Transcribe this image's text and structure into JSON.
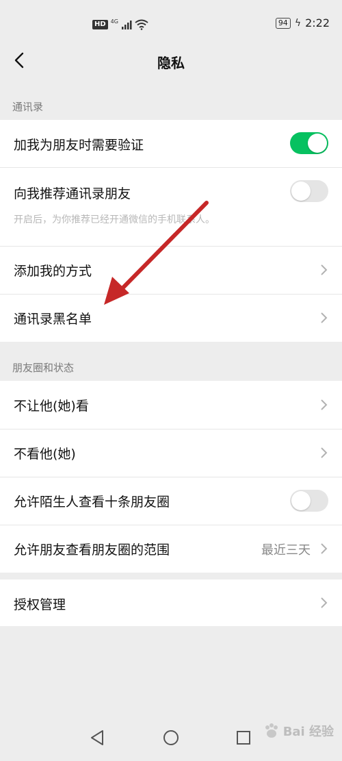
{
  "status_bar": {
    "hd_label": "HD",
    "network_label": "4G",
    "battery_level": "94",
    "time": "2:22"
  },
  "header": {
    "title": "隐私",
    "back_icon": "chevron-left-icon"
  },
  "sections": {
    "contacts": {
      "title": "通讯录",
      "items": [
        {
          "label": "加我为朋友时需要验证",
          "control": "toggle",
          "on": true
        },
        {
          "label": "向我推荐通讯录朋友",
          "sublabel": "开启后，为你推荐已经开通微信的手机联系人。",
          "control": "toggle",
          "on": false
        },
        {
          "label": "添加我的方式",
          "control": "chevron"
        },
        {
          "label": "通讯录黑名单",
          "control": "chevron"
        }
      ]
    },
    "moments": {
      "title": "朋友圈和状态",
      "items": [
        {
          "label": "不让他(她)看",
          "control": "chevron"
        },
        {
          "label": "不看他(她)",
          "control": "chevron"
        },
        {
          "label": "允许陌生人查看十条朋友圈",
          "control": "toggle",
          "on": false
        },
        {
          "label": "允许朋友查看朋友圈的范围",
          "value": "最近三天",
          "control": "chevron"
        }
      ]
    },
    "auth": {
      "items": [
        {
          "label": "授权管理",
          "control": "chevron"
        }
      ]
    }
  },
  "colors": {
    "accent": "#07c160",
    "annotation_arrow": "#c62828",
    "background": "#ededed"
  },
  "watermark": {
    "text": "Bai  经验"
  },
  "nav_bar": {
    "back_icon": "triangle-back-icon",
    "home_icon": "circle-home-icon",
    "recents_icon": "square-recents-icon"
  }
}
